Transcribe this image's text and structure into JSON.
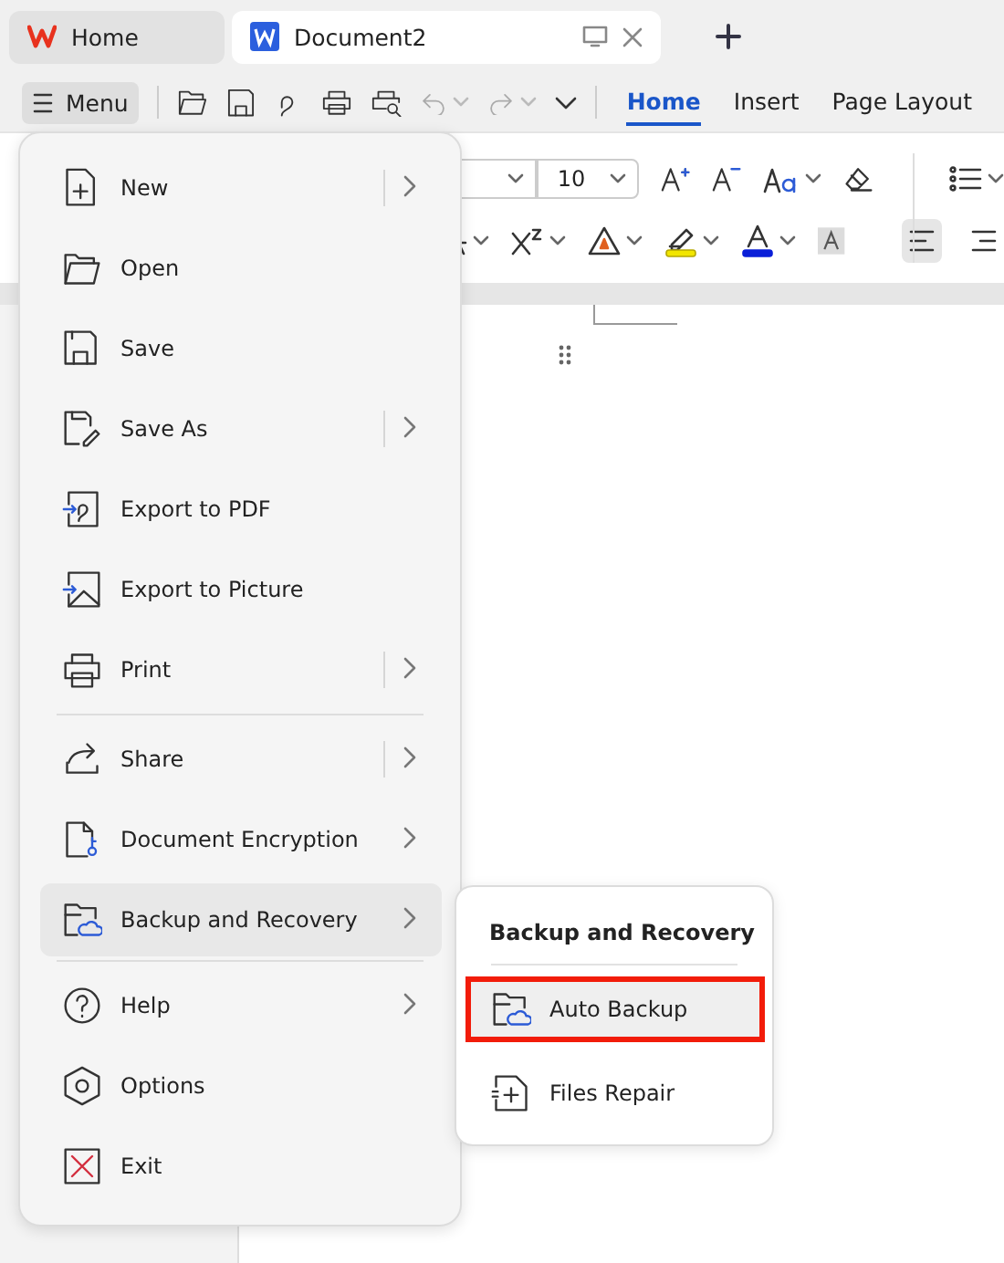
{
  "title_tabs": [
    {
      "label": "Home",
      "selected": false
    },
    {
      "label": "Document2",
      "selected": true
    }
  ],
  "menu_button": "Menu",
  "ribbon_tabs": [
    {
      "label": "Home",
      "selected": true
    },
    {
      "label": "Insert",
      "selected": false
    },
    {
      "label": "Page Layout",
      "selected": false
    }
  ],
  "font_size": "10",
  "alignment_buttons": [
    {
      "selected": true
    },
    {
      "selected": false
    }
  ],
  "menu": {
    "groups": [
      [
        {
          "label": "New",
          "submenu": true,
          "split": true,
          "selected": false
        },
        {
          "label": "Open",
          "submenu": false,
          "split": false,
          "selected": false
        },
        {
          "label": "Save",
          "submenu": false,
          "split": false,
          "selected": false
        },
        {
          "label": "Save As",
          "submenu": true,
          "split": true,
          "selected": false
        },
        {
          "label": "Export to PDF",
          "submenu": false,
          "split": false,
          "selected": false
        },
        {
          "label": "Export to Picture",
          "submenu": false,
          "split": false,
          "selected": false
        },
        {
          "label": "Print",
          "submenu": true,
          "split": true,
          "selected": false
        }
      ],
      [
        {
          "label": "Share",
          "submenu": true,
          "split": true,
          "selected": false
        },
        {
          "label": "Document Encryption",
          "submenu": true,
          "split": false,
          "selected": false
        },
        {
          "label": "Backup and Recovery",
          "submenu": true,
          "split": false,
          "selected": true
        }
      ],
      [
        {
          "label": "Help",
          "submenu": true,
          "split": false,
          "selected": false
        },
        {
          "label": "Options",
          "submenu": false,
          "split": false,
          "selected": false
        },
        {
          "label": "Exit",
          "submenu": false,
          "split": false,
          "selected": false
        }
      ]
    ]
  },
  "submenu": {
    "title": "Backup and Recovery",
    "items": [
      {
        "label": "Auto Backup",
        "selected": true
      },
      {
        "label": "Files Repair",
        "selected": false
      }
    ]
  }
}
